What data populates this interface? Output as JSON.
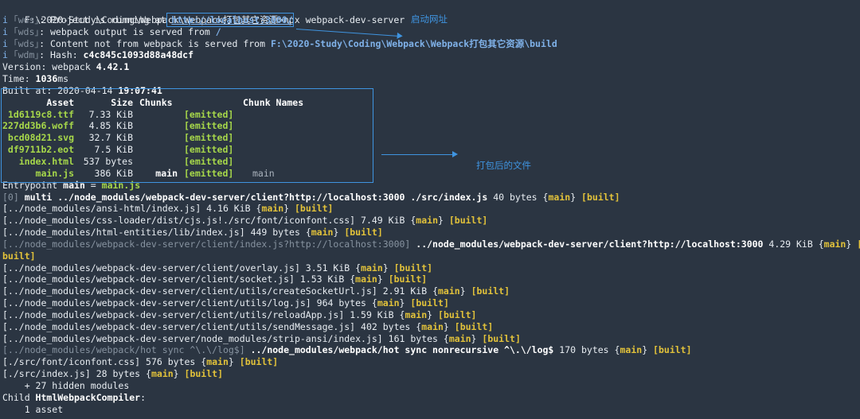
{
  "prompt": {
    "path": "F:\\2020-Study\\Coding\\Webpack\\Webpack打包其它资源",
    "command": ">npx webpack-dev-server"
  },
  "log": {
    "i": "i",
    "wds_tag": "｢wds｣",
    "wdm_tag": "｢wdm｣",
    "line1_text": ": Project is running at ",
    "line1_url": "http://localhost:3000/",
    "line2_text": ": webpack output is served from ",
    "line2_value": "/",
    "line3_text": ": Content not from webpack is served from ",
    "line3_value": "F:\\2020-Study\\Coding\\Webpack\\Webpack打包其它资源\\build",
    "line4_text": ": Hash: ",
    "hash": "c4c845c1093d88a48dcf"
  },
  "build": {
    "version_label": "Version: webpack ",
    "version": "4.42.1",
    "time_label": "Time: ",
    "time": "1036",
    "time_unit": "ms",
    "built_at_label": "Built at: 2020-04-14 ",
    "built_at_time": "19:07:41"
  },
  "assets_table": {
    "headers": {
      "asset": "Asset",
      "size": "Size",
      "chunks": "Chunks",
      "chunk_names": "Chunk Names"
    },
    "rows": [
      {
        "asset": "1d6119c8.ttf",
        "size": "7.33 KiB",
        "chunks": "",
        "status": "[emitted]",
        "chunk_names": ""
      },
      {
        "asset": "227dd3b6.woff",
        "size": "4.85 KiB",
        "chunks": "",
        "status": "[emitted]",
        "chunk_names": ""
      },
      {
        "asset": "bcd08d21.svg",
        "size": "32.7 KiB",
        "chunks": "",
        "status": "[emitted]",
        "chunk_names": ""
      },
      {
        "asset": "df9711b2.eot",
        "size": "7.5 KiB",
        "chunks": "",
        "status": "[emitted]",
        "chunk_names": ""
      },
      {
        "asset": "index.html",
        "size": "537 bytes",
        "chunks": "",
        "status": "[emitted]",
        "chunk_names": ""
      },
      {
        "asset": "main.js",
        "size": "386 KiB",
        "chunks": "main",
        "status": "[emitted]",
        "chunk_names": "main"
      }
    ]
  },
  "entrypoint": {
    "label": "Entrypoint ",
    "name": "main",
    "eq": " = ",
    "file": "main.js"
  },
  "modules": [
    {
      "prefix": "[0] ",
      "path": "multi ../node_modules/webpack-dev-server/client?http://localhost:3000 ./src/index.js",
      "size": " 40 bytes ",
      "chunk": "main",
      "status": "[built]"
    },
    {
      "prefix": "",
      "path": "[../node_modules/ansi-html/index.js]",
      "size": " 4.16 KiB ",
      "chunk": "main",
      "status": "[built]"
    },
    {
      "prefix": "",
      "path": "[../node_modules/css-loader/dist/cjs.js!./src/font/iconfont.css]",
      "size": " 7.49 KiB ",
      "chunk": "main",
      "status": "[built]"
    },
    {
      "prefix": "",
      "path": "[../node_modules/html-entities/lib/index.js]",
      "size": " 449 bytes ",
      "chunk": "main",
      "status": "[built]"
    },
    {
      "prefix": "[../node_modules/webpack-dev-server/client/index.js?http://localhost:3000] ",
      "path": "../node_modules/webpack-dev-server/client?http://localhost:3000",
      "size": " 4.29 KiB ",
      "chunk": "main",
      "status": "[",
      "wrap": "built]"
    },
    {
      "prefix": "",
      "path": "[../node_modules/webpack-dev-server/client/overlay.js]",
      "size": " 3.51 KiB ",
      "chunk": "main",
      "status": "[built]"
    },
    {
      "prefix": "",
      "path": "[../node_modules/webpack-dev-server/client/socket.js]",
      "size": " 1.53 KiB ",
      "chunk": "main",
      "status": "[built]"
    },
    {
      "prefix": "",
      "path": "[../node_modules/webpack-dev-server/client/utils/createSocketUrl.js]",
      "size": " 2.91 KiB ",
      "chunk": "main",
      "status": "[built]"
    },
    {
      "prefix": "",
      "path": "[../node_modules/webpack-dev-server/client/utils/log.js]",
      "size": " 964 bytes ",
      "chunk": "main",
      "status": "[built]"
    },
    {
      "prefix": "",
      "path": "[../node_modules/webpack-dev-server/client/utils/reloadApp.js]",
      "size": " 1.59 KiB ",
      "chunk": "main",
      "status": "[built]"
    },
    {
      "prefix": "",
      "path": "[../node_modules/webpack-dev-server/client/utils/sendMessage.js]",
      "size": " 402 bytes ",
      "chunk": "main",
      "status": "[built]"
    },
    {
      "prefix": "",
      "path": "[../node_modules/webpack-dev-server/node_modules/strip-ansi/index.js]",
      "size": " 161 bytes ",
      "chunk": "main",
      "status": "[built]"
    },
    {
      "prefix": "[../node_modules/webpack/hot sync ^\\.\\/log$] ",
      "path": "../node_modules/webpack/hot sync nonrecursive ^\\.\\/log$",
      "size": " 170 bytes ",
      "chunk": "main",
      "status": "[built]"
    },
    {
      "prefix": "",
      "path": "[./src/font/iconfont.css]",
      "size": " 576 bytes ",
      "chunk": "main",
      "status": "[built]"
    },
    {
      "prefix": "",
      "path": "[./src/index.js]",
      "size": " 28 bytes ",
      "chunk": "main",
      "status": "[built]"
    }
  ],
  "footer": {
    "hidden": "    + 27 hidden modules",
    "child_label": "Child ",
    "child_name": "HtmlWebpackCompiler",
    "child_colon": ":",
    "asset_count": "    1 asset"
  },
  "annotations": {
    "start_url": "启动网址",
    "bundled_files": "打包后的文件",
    "color": "#3f94e0"
  }
}
